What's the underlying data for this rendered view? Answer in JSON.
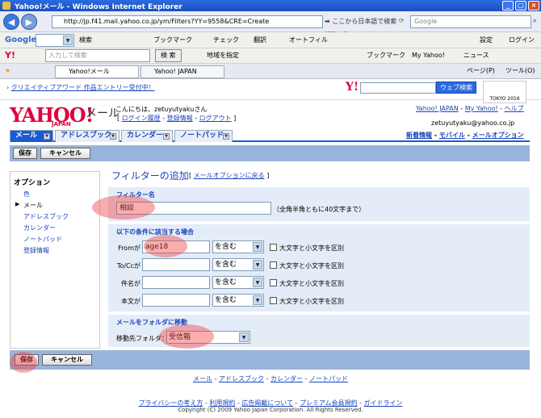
{
  "browser": {
    "title": "Yahoo!メール - Windows Internet Explorer",
    "url": "http://jp.f41.mail.yahoo.co.jp/ym/Filters?YY=9558&CRE=Create",
    "jword_hint": "ここから日本語で検索(JWord)",
    "search_placeholder": "Google",
    "google_label": "Google",
    "toolbar_search": "検索",
    "bookmark": "ブックマーク",
    "check": "チェック",
    "translate": "翻訳",
    "autofill": "オートフィル",
    "settings": "設定",
    "login": "ログイン",
    "y_input_placeholder": "入力して検索",
    "y_search": "検 索",
    "map": "地域を指定",
    "y_bookmark": "ブックマーク",
    "my_yahoo": "My Yahoo!",
    "news": "ニュース",
    "tab1": "Yahoo!メール",
    "tab2": "Yahoo! JAPAN",
    "page_menu": "ページ(P)",
    "tools_menu": "ツール(O)"
  },
  "yahoo_top": {
    "creative_link": "クリエイティブアワード 作品エントリー受付中！",
    "web_search": "ウェブ検索",
    "tokyo": "TOKYO 2016",
    "logo_small": "Y!"
  },
  "header": {
    "logo": "YAHOO!",
    "logo_sub": "JAPAN",
    "mail": "メール",
    "hello": "こんにちは、zetuyutyakuさん",
    "login_history": "ログイン履歴",
    "registration": "登録情報",
    "logout": "ログアウト",
    "yj_link": "Yahoo! JAPAN",
    "myyahoo_link": "My Yahoo!",
    "help_link": "ヘルプ",
    "email": "zetuyutyaku@yahoo.co.jp"
  },
  "nav": {
    "tabs": [
      "メール",
      "アドレスブック",
      "カレンダー",
      "ノートパッド"
    ],
    "right": [
      "新着情報",
      "モバイル",
      "メールオプション"
    ]
  },
  "buttons": {
    "save": "保存",
    "cancel": "キャンセル"
  },
  "sidebar": {
    "title": "オプション",
    "items": [
      "色",
      "メール",
      "アドレスブック",
      "カレンダー",
      "ノートパッド",
      "登録情報"
    ]
  },
  "main": {
    "title": "フィルターの追加",
    "back_link": "メールオプションに戻る",
    "filter_name_label": "フィルター名",
    "filter_name_value": "相談",
    "filter_name_hint": "（全角半角ともに40文字まで）",
    "conditions_label": "以下の条件に該当する場合",
    "rows": [
      {
        "label": "Fromが",
        "value": "age18",
        "op": "を含む",
        "case": "大文字と小文字を区別"
      },
      {
        "label": "To/Ccが",
        "value": "",
        "op": "を含む",
        "case": "大文字と小文字を区別"
      },
      {
        "label": "件名が",
        "value": "",
        "op": "を含む",
        "case": "大文字と小文字を区別"
      },
      {
        "label": "本文が",
        "value": "",
        "op": "を含む",
        "case": "大文字と小文字を区別"
      }
    ],
    "move_label": "メールをフォルダに移動",
    "dest_label": "移動先フォルダ：",
    "dest_value": "受信箱"
  },
  "footer": {
    "links": [
      "メール",
      "アドレスブック",
      "カレンダー",
      "ノートパッド"
    ],
    "policy": [
      "プライバシーの考え方",
      "利用規約",
      "広告掲載について",
      "プレミアム会員規約",
      "ガイドライン"
    ],
    "copyright": "Copyright (C) 2009 Yahoo Japan Corporation. All Rights Reserved."
  },
  "colors": {
    "accent": "#1a5cd0",
    "brand": "#e0003c",
    "highlight": "#f03c3c"
  }
}
